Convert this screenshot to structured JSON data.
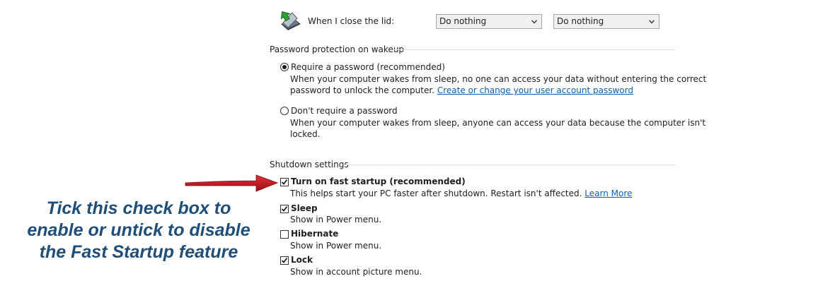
{
  "lid": {
    "label": "When I close the lid:",
    "on_battery": "Do nothing",
    "plugged_in": "Do nothing"
  },
  "password": {
    "section_title": "Password protection on wakeup",
    "require": {
      "label": "Require a password (recommended)",
      "desc_line1": "When your computer wakes from sleep, no one can access your data without entering the correct",
      "desc_line2": "password to unlock the computer.",
      "link": "Create or change your user account password",
      "selected": true
    },
    "no_require": {
      "label": "Don't require a password",
      "desc_line1": "When your computer wakes from sleep, anyone can access your data because the computer isn't",
      "desc_line2": "locked.",
      "selected": false
    }
  },
  "shutdown": {
    "section_title": "Shutdown settings",
    "fast_startup": {
      "label": "Turn on fast startup (recommended)",
      "desc": "This helps start your PC faster after shutdown. Restart isn't affected.",
      "link": "Learn More",
      "checked": true
    },
    "sleep": {
      "label": "Sleep",
      "desc": "Show in Power menu.",
      "checked": true
    },
    "hibernate": {
      "label": "Hibernate",
      "desc": "Show in Power menu.",
      "checked": false
    },
    "lock": {
      "label": "Lock",
      "desc": "Show in account picture menu.",
      "checked": true
    }
  },
  "annotation": {
    "line1": "Tick this check box to",
    "line2": "enable or untick to disable",
    "line3": "the Fast Startup feature"
  },
  "colors": {
    "annotation_text": "#1f4e79",
    "arrow": "#c0141c",
    "link": "#0b5eb8"
  },
  "icons": {
    "lid": "laptop-lid-icon",
    "arrow": "red-arrow-icon",
    "check": "check-icon",
    "dropdown": "chevron-down-icon"
  }
}
